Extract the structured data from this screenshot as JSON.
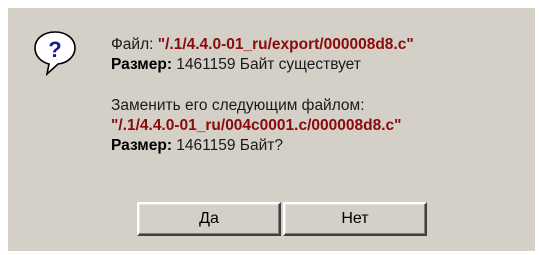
{
  "dialog": {
    "icon": "question-icon",
    "icon_glyph": "?",
    "file_label": "Файл: ",
    "existing_path": "\"/.1/4.4.0-01_ru/export/000008d8.c\"",
    "size_label": "Размер:",
    "existing_size_text": " 1461159 Байт существует",
    "replace_prompt": "Заменить его следующим файлом:",
    "new_path": "\"/.1/4.4.0-01_ru/004c0001.c/000008d8.c\"",
    "new_size_text": " 1461159 Байт?"
  },
  "buttons": {
    "yes_label": "Да",
    "no_label": "Нет"
  },
  "colors": {
    "background": "#d4d0c8",
    "path_color": "#8b0a0a",
    "icon_blue": "#1a1a8c"
  }
}
